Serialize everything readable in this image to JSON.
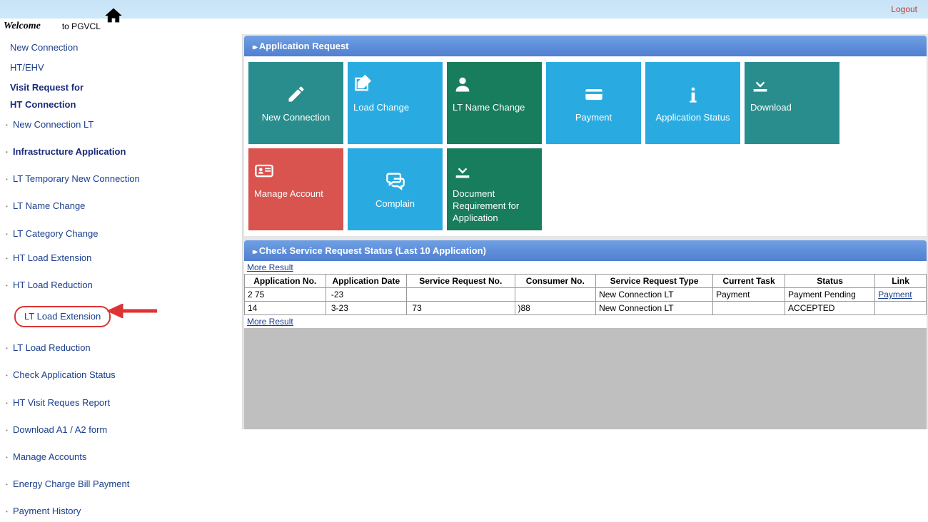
{
  "topbar": {
    "logout": "Logout"
  },
  "welcome": {
    "prefix": "Welcome",
    "suffix": "to PGVCL"
  },
  "sidebar": {
    "items": [
      {
        "label": "New Connection",
        "type": "plain"
      },
      {
        "label": "HT/EHV",
        "type": "plain"
      },
      {
        "label": "Visit Request for",
        "type": "bold"
      },
      {
        "label": "HT Connection",
        "type": "bold-cont"
      },
      {
        "label": "New Connection LT",
        "type": "sub"
      },
      {
        "label": "Infrastructure Application",
        "type": "sub bold spaced"
      },
      {
        "label": "LT Temporary New Connection",
        "type": "sub spaced"
      },
      {
        "label": "LT Name Change",
        "type": "sub spaced"
      },
      {
        "label": "LT Category Change",
        "type": "sub spaced"
      },
      {
        "label": "HT Load Extension",
        "type": "sub spaced-sm"
      },
      {
        "label": "HT Load Reduction",
        "type": "sub spaced"
      },
      {
        "label": "LT Load Extension",
        "type": "highlighted spaced"
      },
      {
        "label": "LT Load Reduction",
        "type": "sub spaced"
      },
      {
        "label": "Check Application Status",
        "type": "sub spaced"
      },
      {
        "label": "HT Visit Reques Report",
        "type": "sub spaced"
      },
      {
        "label": "Download A1 / A2 form",
        "type": "sub spaced"
      },
      {
        "label": "Manage Accounts",
        "type": "sub spaced"
      },
      {
        "label": "Energy Charge Bill Payment",
        "type": "sub spaced"
      },
      {
        "label": "Payment History",
        "type": "sub spaced"
      }
    ]
  },
  "panels": {
    "app_request": "Application Request",
    "status_check": "Check Service Request Status (Last 10 Application)"
  },
  "tiles": [
    {
      "label": "New Connection",
      "color": "c-teal",
      "icon": "pencil"
    },
    {
      "label": "Load Change",
      "color": "c-cyan",
      "icon": "edit-box",
      "align": "left"
    },
    {
      "label": "LT Name Change",
      "color": "c-green",
      "icon": "person",
      "align": "left"
    },
    {
      "label": "Payment",
      "color": "c-cyan",
      "icon": "card"
    },
    {
      "label": "Application Status",
      "color": "c-cyan",
      "icon": "info"
    },
    {
      "label": "Download",
      "color": "c-teal",
      "icon": "download",
      "align": "left"
    },
    {
      "label": "Manage Account",
      "color": "c-red",
      "icon": "id-card",
      "align": "left"
    },
    {
      "label": "Complain",
      "color": "c-cyan",
      "icon": "chat"
    },
    {
      "label": "Document Requirement for Application",
      "color": "c-green",
      "icon": "download",
      "align": "left"
    }
  ],
  "table": {
    "more": "More Result",
    "headers": [
      "Application No.",
      "Application Date",
      "Service Request No.",
      "Consumer No.",
      "Service Request Type",
      "Current Task",
      "Status",
      "Link"
    ],
    "rows": [
      {
        "app_no": "2      ‍75",
        "app_date": "‍         -23",
        "srv_no": "",
        "cons_no": "",
        "srv_type": "New Connection LT",
        "task": "Payment",
        "status": "Payment Pending",
        "link": "Payment"
      },
      {
        "app_no": "        14",
        "app_date": "‍        3-23",
        "srv_no": "‍         73",
        "cons_no": "           ‍)88",
        "srv_type": "New Connection LT",
        "task": "",
        "status": "ACCEPTED",
        "link": ""
      }
    ]
  }
}
